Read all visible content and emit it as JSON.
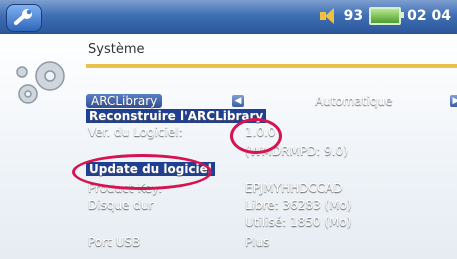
{
  "status": {
    "volume": "93",
    "time": "02 04"
  },
  "header": {
    "title": "Système"
  },
  "settings": {
    "arc_label": "ARCLibrary",
    "arc_value": "Automatique",
    "rebuild_label": "Reconstruire l'ARCLibrary",
    "software_label": "Ver. du Logiciel:",
    "software_value": "1.0.0",
    "software_sub": "(WMDRMPD: 9.0)",
    "update_label": "Update du logiciel",
    "product_key_label": "Product Key:",
    "product_key_value": "EPJMYHHDCCAD",
    "disk_label": "Disque dur",
    "disk_free": "Libre: 36283 (Mo)",
    "disk_used": "Utilisé: 1850 (Mo)",
    "usb_label": "Port USB",
    "usb_value": "Plus"
  },
  "colors": {
    "accent": "#1f3f92",
    "highlight_ring": "#d6124f",
    "title_rule": "#e9c04a"
  }
}
